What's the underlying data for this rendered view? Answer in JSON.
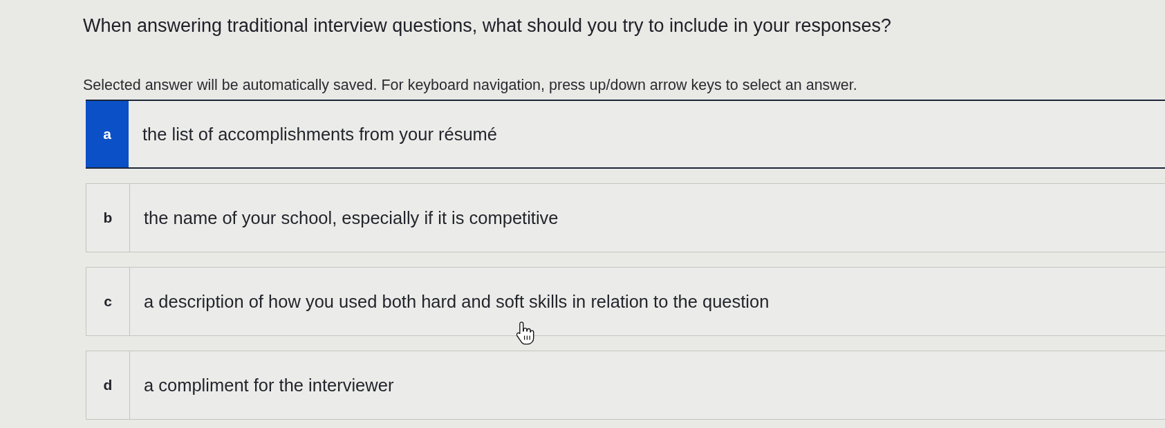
{
  "question": "When answering traditional interview questions, what should you try to include in your responses?",
  "instructions": "Selected answer will be automatically saved. For keyboard navigation, press up/down arrow keys to select an answer.",
  "options": [
    {
      "letter": "a",
      "text": "the list of accomplishments from your résumé",
      "selected": true
    },
    {
      "letter": "b",
      "text": "the name of your school, especially if it is competitive",
      "selected": false
    },
    {
      "letter": "c",
      "text": "a description of how you used both hard and soft skills in relation to the question",
      "selected": false
    },
    {
      "letter": "d",
      "text": "a compliment for the interviewer",
      "selected": false
    }
  ]
}
